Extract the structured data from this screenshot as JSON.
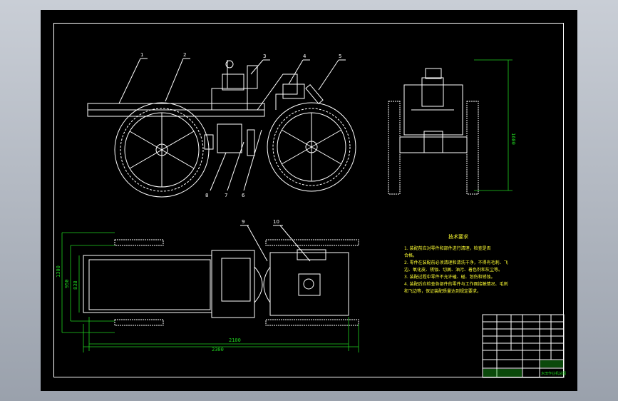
{
  "drawing": {
    "sheet_color": "#000000",
    "line_color": "#ffffff",
    "dimension_color": "#1fd21f",
    "text_color": "#ffff33"
  },
  "callouts": [
    "1",
    "2",
    "3",
    "4",
    "5",
    "6",
    "7",
    "8",
    "9",
    "10"
  ],
  "dimensions": {
    "height": "1600",
    "width_1": "1300",
    "width_2": "950",
    "width_3": "838",
    "length_1": "2100",
    "length_2": "2300"
  },
  "notes": {
    "title": "技术要求",
    "items": [
      "1. 装配前应对零件和部件进行清理，检查是否",
      "   合格。",
      "2. 零件在装配前必须清理和清洗干净，不得有毛刺、飞",
      "   边、氧化皮、锈蚀、切屑、油污、着色剂和灰尘等。",
      "3. 装配过程中零件不允许磕、碰、划伤和锈蚀。",
      "4. 装配后应检查各部件的零件与工作面接触情况、毛刺",
      "   和飞边等，保证装配质量达到规定要求。"
    ]
  },
  "title_block": {
    "drawing_name": "水田作业机总图"
  }
}
